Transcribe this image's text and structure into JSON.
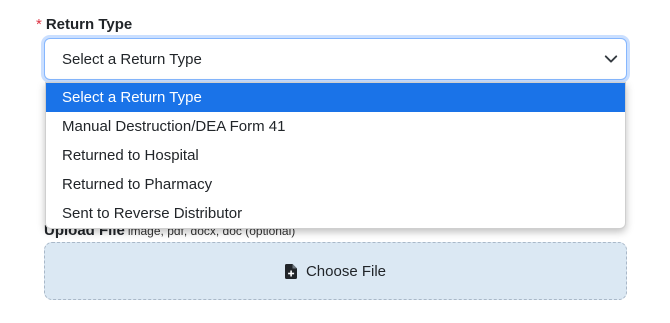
{
  "form": {
    "return_type": {
      "required_mark": "*",
      "label": "Return Type",
      "selected_value": "Select a Return Type",
      "options": [
        "Select a Return Type",
        "Manual Destruction/DEA Form 41",
        "Returned to Hospital",
        "Returned to Pharmacy",
        "Sent to Reverse Distributor"
      ],
      "highlighted_index": 0
    },
    "upload": {
      "label": "Upload File",
      "hint": "image, pdf, docx, doc (optional)",
      "button_label": "Choose File"
    }
  },
  "colors": {
    "accent": "#1a73e8",
    "required": "#dc3545",
    "upload_bg": "#dbe8f3"
  },
  "icons": {
    "select_caret": "chevron-down-icon",
    "upload": "file-plus-icon"
  }
}
